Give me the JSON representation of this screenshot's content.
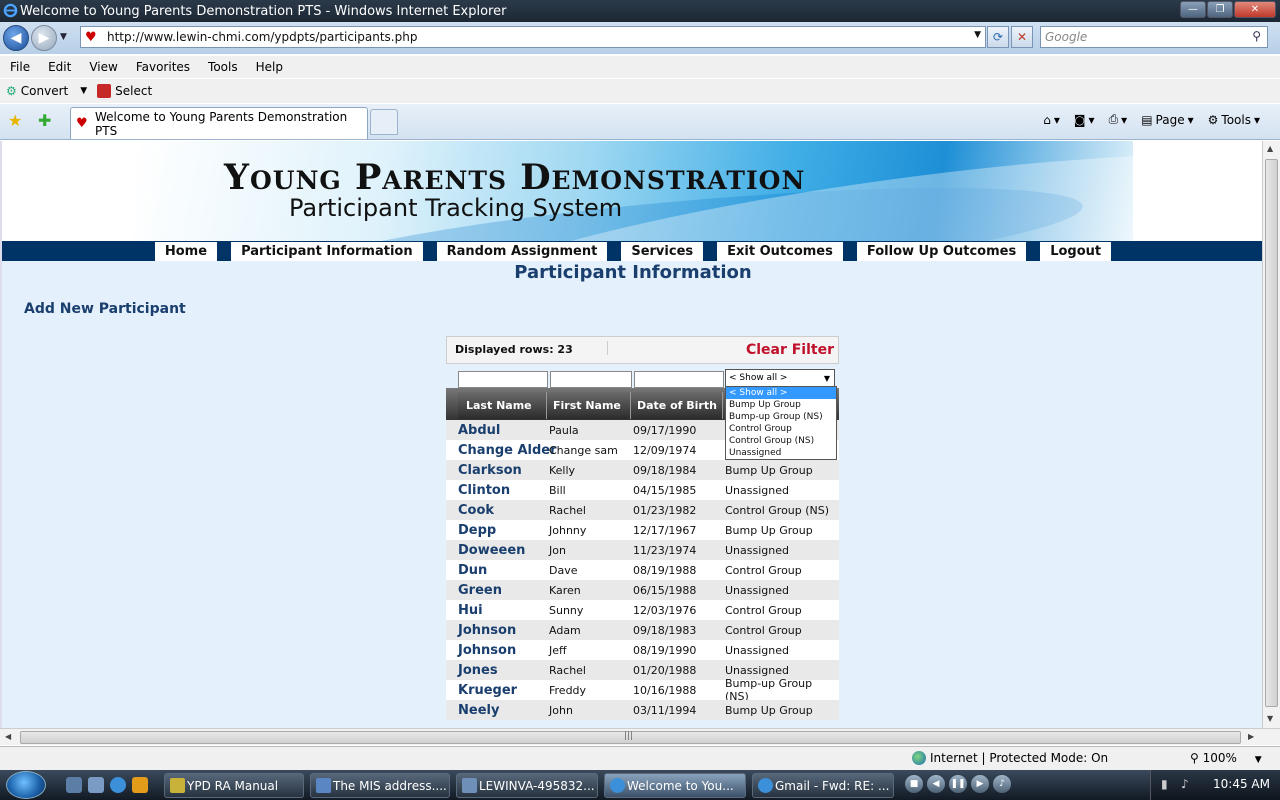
{
  "window": {
    "title": "Welcome to Young Parents Demonstration PTS - Windows Internet Explorer"
  },
  "browser": {
    "url": "http://www.lewin-chmi.com/ypdpts/participants.php",
    "search_placeholder": "Google",
    "menu": [
      "File",
      "Edit",
      "View",
      "Favorites",
      "Tools",
      "Help"
    ],
    "convert_label": "Convert",
    "select_label": "Select",
    "tab_title": "Welcome to Young Parents Demonstration PTS",
    "cmd_page": "Page",
    "cmd_tools": "Tools"
  },
  "site": {
    "banner_title": "Young Parents Demonstration",
    "banner_subtitle": "Participant Tracking System",
    "nav": [
      "Home",
      "Participant Information",
      "Random Assignment",
      "Services",
      "Exit Outcomes",
      "Follow Up Outcomes",
      "Logout"
    ],
    "page_title": "Participant Information",
    "add_new": "Add New Participant"
  },
  "grid": {
    "displayed_rows_label": "Displayed rows: 23",
    "clear_filter": "Clear Filter",
    "filter_selected": "< Show all >",
    "columns": [
      "Last Name",
      "First Name",
      "Date of Birth"
    ],
    "dropdown_options": [
      "< Show all >",
      "Bump Up Group",
      "Bump-up Group (NS)",
      "Control Group",
      "Control Group (NS)",
      "Unassigned"
    ],
    "rows": [
      {
        "last": "Abdul",
        "first": "Paula",
        "dob": "09/17/1990",
        "group": ""
      },
      {
        "last": "Change Alder",
        "first": "Change sam",
        "dob": "12/09/1974",
        "group": ""
      },
      {
        "last": "Clarkson",
        "first": "Kelly",
        "dob": "09/18/1984",
        "group": "Bump Up Group"
      },
      {
        "last": "Clinton",
        "first": "Bill",
        "dob": "04/15/1985",
        "group": "Unassigned"
      },
      {
        "last": "Cook",
        "first": "Rachel",
        "dob": "01/23/1982",
        "group": "Control Group (NS)"
      },
      {
        "last": "Depp",
        "first": "Johnny",
        "dob": "12/17/1967",
        "group": "Bump Up Group"
      },
      {
        "last": "Doweeen",
        "first": "Jon",
        "dob": "11/23/1974",
        "group": "Unassigned"
      },
      {
        "last": "Dun",
        "first": "Dave",
        "dob": "08/19/1988",
        "group": "Control Group"
      },
      {
        "last": "Green",
        "first": "Karen",
        "dob": "06/15/1988",
        "group": "Unassigned"
      },
      {
        "last": "Hui",
        "first": "Sunny",
        "dob": "12/03/1976",
        "group": "Control Group"
      },
      {
        "last": "Johnson",
        "first": "Adam",
        "dob": "09/18/1983",
        "group": "Control Group"
      },
      {
        "last": "Johnson",
        "first": "Jeff",
        "dob": "08/19/1990",
        "group": "Unassigned"
      },
      {
        "last": "Jones",
        "first": "Rachel",
        "dob": "01/20/1988",
        "group": "Unassigned"
      },
      {
        "last": "Krueger",
        "first": "Freddy",
        "dob": "10/16/1988",
        "group": "Bump-up Group (NS)"
      },
      {
        "last": "Neely",
        "first": "John",
        "dob": "03/11/1994",
        "group": "Bump Up Group"
      }
    ]
  },
  "statusbar": {
    "zone": "Internet | Protected Mode: On",
    "zoom": "100%"
  },
  "taskbar": {
    "buttons": [
      "YPD RA Manual",
      "The MIS address....",
      "LEWINVA-495832...",
      "Welcome to You...",
      "Gmail - Fwd: RE: ..."
    ],
    "clock": "10:45 AM"
  }
}
